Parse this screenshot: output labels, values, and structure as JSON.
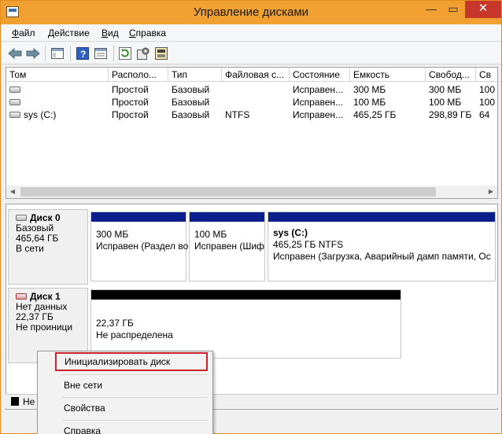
{
  "window": {
    "title": "Управление дисками",
    "min": "—",
    "max": "▭",
    "close": "✕"
  },
  "menu": [
    {
      "key": "Ф",
      "rest": "айл"
    },
    {
      "key": "Д",
      "rest": "ействие"
    },
    {
      "key": "В",
      "rest": "ид"
    },
    {
      "key": "С",
      "rest": "правка"
    }
  ],
  "toolbar": [
    "back-arrow-icon",
    "forward-arrow-icon",
    "console-tree-icon",
    "help-icon",
    "properties-list-icon",
    "refresh-icon",
    "settings-icon",
    "disk-properties-icon"
  ],
  "volumes": {
    "columns": [
      "Том",
      "Располо...",
      "Тип",
      "Файловая с...",
      "Состояние",
      "Емкость",
      "Свобод...",
      "Св"
    ],
    "rows": [
      [
        "",
        "Простой",
        "Базовый",
        "",
        "Исправен...",
        "300 МБ",
        "300 МБ",
        "100"
      ],
      [
        "",
        "Простой",
        "Базовый",
        "",
        "Исправен...",
        "100 МБ",
        "100 МБ",
        "100"
      ],
      [
        "sys (C:)",
        "Простой",
        "Базовый",
        "NTFS",
        "Исправен...",
        "465,25 ГБ",
        "298,89 ГБ",
        "64"
      ]
    ]
  },
  "disks": [
    {
      "name": "Диск 0",
      "line1": "Базовый",
      "line2": "465,64 ГБ",
      "line3": "В сети",
      "partitions": [
        {
          "title": "",
          "size": "300 МБ",
          "status": "Исправен (Раздел во",
          "bar": "#0a1e8c"
        },
        {
          "title": "",
          "size": "100 МБ",
          "status": "Исправен (Шиф",
          "bar": "#0a1e8c"
        },
        {
          "title": "sys  (C:)",
          "size": "465,25 ГБ NTFS",
          "status": "Исправен (Загрузка, Аварийный дамп памяти, Ос",
          "bar": "#0a1e8c"
        }
      ]
    },
    {
      "name": "Диск 1",
      "line1": "Нет данных",
      "line2": "22,37 ГБ",
      "line3": "Не проиници",
      "partitions": [
        {
          "title": "",
          "size": "22,37 ГБ",
          "status": "Не распределена",
          "bar": "#000000"
        }
      ]
    }
  ],
  "legend": {
    "label": "Не"
  },
  "context_menu": {
    "items": [
      "Инициализировать диск",
      "Вне сети",
      "Свойства",
      "Справка"
    ],
    "highlighted": 0
  },
  "colors": {
    "title_bar": "#f0a030",
    "primary_partition": "#0a1e8c",
    "unallocated": "#000000",
    "highlight_border": "#c8232c"
  }
}
